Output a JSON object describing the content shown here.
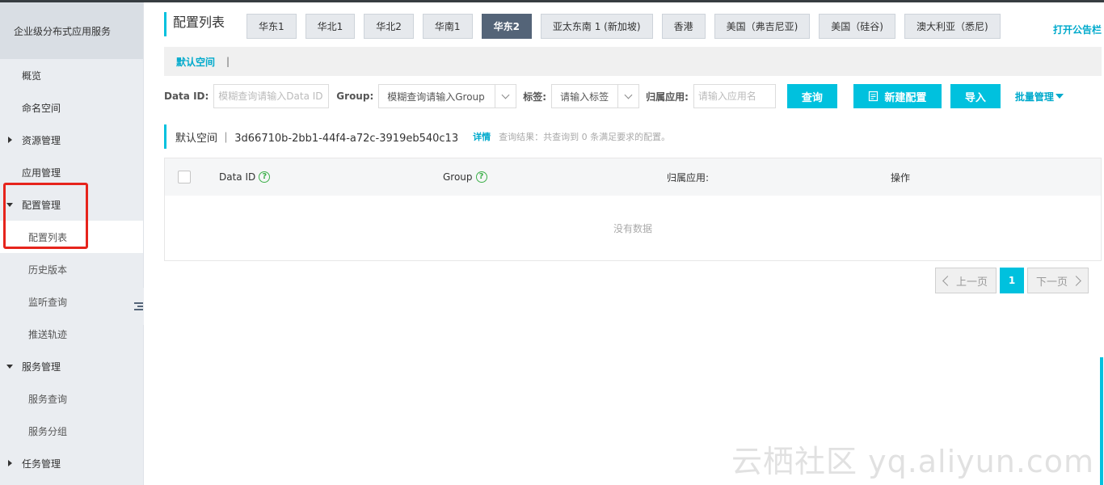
{
  "sidebar": {
    "title": "企业级分布式应用服务",
    "items": [
      {
        "label": "概览"
      },
      {
        "label": "命名空间"
      },
      {
        "label": "资源管理"
      },
      {
        "label": "应用管理"
      },
      {
        "label": "配置管理"
      },
      {
        "label": "配置列表"
      },
      {
        "label": "历史版本"
      },
      {
        "label": "监听查询"
      },
      {
        "label": "推送轨迹"
      },
      {
        "label": "服务管理"
      },
      {
        "label": "服务查询"
      },
      {
        "label": "服务分组"
      },
      {
        "label": "任务管理"
      }
    ]
  },
  "header": {
    "title": "配置列表",
    "regions": [
      "华东1",
      "华北1",
      "华北2",
      "华南1",
      "华东2",
      "亚太东南 1 (新加坡)",
      "香港",
      "美国（弗吉尼亚)",
      "美国（硅谷)",
      "澳大利亚（悉尼)"
    ],
    "active_region": "华东2",
    "notice_link": "打开公告栏"
  },
  "namespace_bar": {
    "active": "默认空间",
    "separator": "|"
  },
  "filters": {
    "data_id_label": "Data ID:",
    "data_id_placeholder": "模糊查询请输入Data ID",
    "group_label": "Group:",
    "group_value": "模糊查询请输入Group",
    "tag_label": "标签:",
    "tag_value": "请输入标签",
    "app_label": "归属应用:",
    "app_placeholder": "请输入应用名",
    "query_button": "查询",
    "new_button": "新建配置",
    "import_button": "导入",
    "batch_link": "批量管理"
  },
  "namespace_info": {
    "name": "默认空间 ｜ 3d66710b-2bb1-44f4-a72c-3919eb540c13",
    "detail": "详情",
    "result": "查询结果：共查询到 0 条满足要求的配置。"
  },
  "table": {
    "columns": [
      "Data ID",
      "Group",
      "归属应用:",
      "操作"
    ],
    "empty_text": "没有数据"
  },
  "pagination": {
    "prev": "上一页",
    "current": "1",
    "next": "下一页"
  },
  "watermark": "云栖社区 yq.aliyun.com",
  "colors": {
    "accent": "#00c1de",
    "link": "#00aacc",
    "active_tab": "#546478",
    "highlight_box": "#e6241c"
  }
}
